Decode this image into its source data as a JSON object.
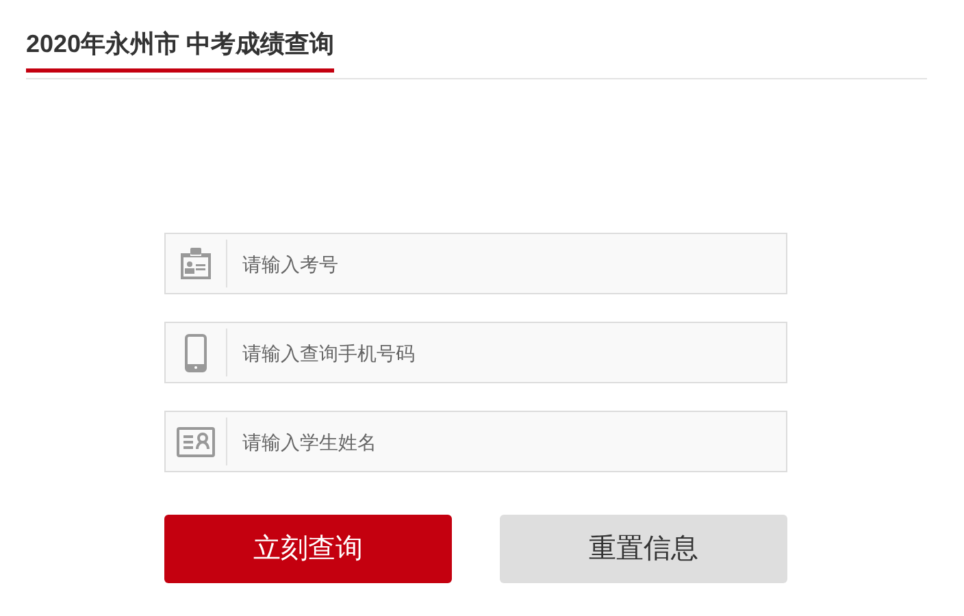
{
  "title": "2020年永州市 中考成绩查询",
  "fields": [
    {
      "kind": "badge",
      "placeholder": "请输入考号"
    },
    {
      "kind": "phone",
      "placeholder": "请输入查询手机号码"
    },
    {
      "kind": "idcard",
      "placeholder": "请输入学生姓名"
    }
  ],
  "buttons": [
    {
      "kind": "primary",
      "label": "立刻查询"
    },
    {
      "kind": "secondary",
      "label": "重置信息"
    }
  ]
}
